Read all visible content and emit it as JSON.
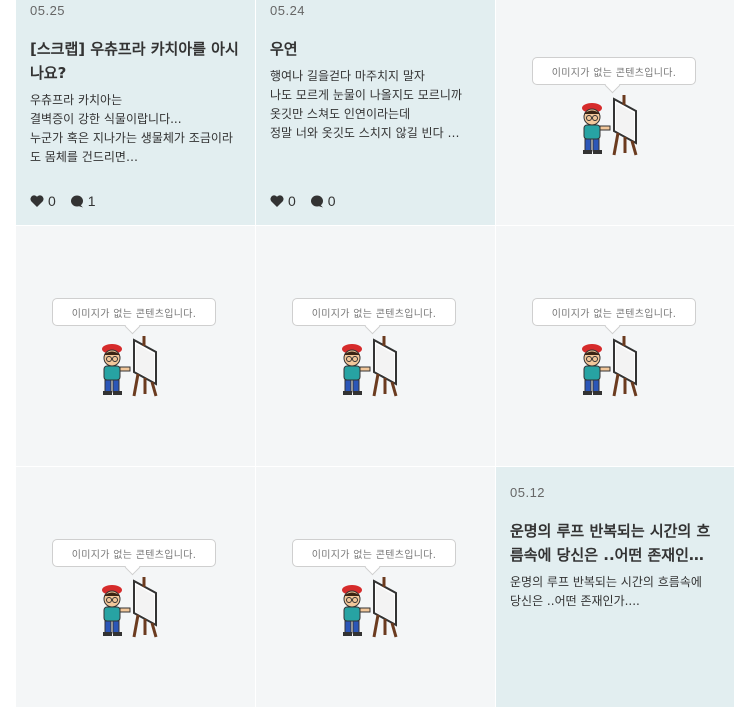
{
  "cards": [
    {
      "date": "05.25",
      "title": "[스크랩] 우츄프라 카치아를 아시나요?",
      "excerpt": "우츄프라 카치아는\n결벽증이 강한 식물이랍니다...\n누군가 혹은 지나가는 생물체가 조금이라도 몸체를 건드리면…",
      "likes": "0",
      "comments": "1"
    },
    {
      "date": "05.24",
      "title": "우연",
      "excerpt": "행여나 길을걷다 마주치지 말자\n나도 모르게 눈물이 나올지도 모르니까\n옷깃만 스쳐도 인연이라는데\n정말 너와 옷깃도 스치지 않길 빈다 …",
      "likes": "0",
      "comments": "0"
    },
    {
      "date": "05.12",
      "title": "운명의 루프 반복되는 시간의 흐름속에 당신은 ..어떤 존재인…",
      "excerpt": "운명의 루프 반복되는 시간의 흐름속에\n당신은 ..어떤 존재인가....",
      "likes": "",
      "comments": ""
    }
  ],
  "no_image_text": "이미지가 없는 콘텐츠입니다.",
  "icons": {
    "like": "heart-icon",
    "comment": "comment-icon"
  },
  "colors": {
    "card_bg": "#e2eef0",
    "empty_bg": "#f4f6f7",
    "text": "#333333"
  }
}
